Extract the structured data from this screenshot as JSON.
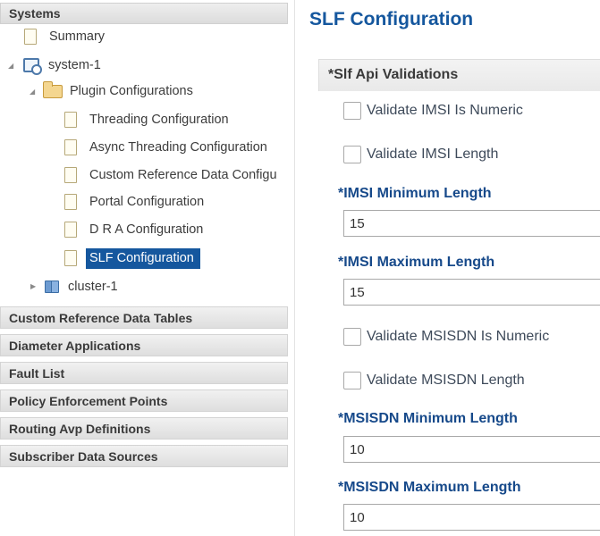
{
  "sidebar": {
    "header": "Systems",
    "tree": {
      "summary": "Summary",
      "system": "system-1",
      "plugin_folder": "Plugin Configurations",
      "plugins": [
        "Threading Configuration",
        "Async Threading Configuration",
        "Custom Reference Data Configu",
        "Portal Configuration",
        "D R A Configuration",
        "SLF Configuration"
      ],
      "cluster": "cluster-1"
    },
    "sections": [
      "Custom Reference Data Tables",
      "Diameter Applications",
      "Fault List",
      "Policy Enforcement Points",
      "Routing Avp Definitions",
      "Subscriber Data Sources"
    ],
    "selected": "SLF Configuration"
  },
  "main": {
    "title": "SLF Configuration",
    "group_title": "*Slf Api Validations",
    "checkboxes": {
      "imsi_numeric": "Validate IMSI Is Numeric",
      "imsi_length": "Validate IMSI Length",
      "msisdn_numeric": "Validate MSISDN Is Numeric",
      "msisdn_length": "Validate MSISDN Length"
    },
    "fields": {
      "imsi_min": {
        "label": "*IMSI Minimum Length",
        "value": "15"
      },
      "imsi_max": {
        "label": "*IMSI Maximum Length",
        "value": "15"
      },
      "msisdn_min": {
        "label": "*MSISDN Minimum Length",
        "value": "10"
      },
      "msisdn_max": {
        "label": "*MSISDN Maximum Length",
        "value": "10"
      }
    }
  },
  "colors": {
    "accent": "#15579e",
    "label_blue": "#16498a",
    "selection_bg": "#15579e"
  },
  "icons": [
    "document-icon",
    "system-icon",
    "folder-open-icon",
    "cluster-icon",
    "expand-arrow-icon",
    "collapse-arrow-icon"
  ]
}
